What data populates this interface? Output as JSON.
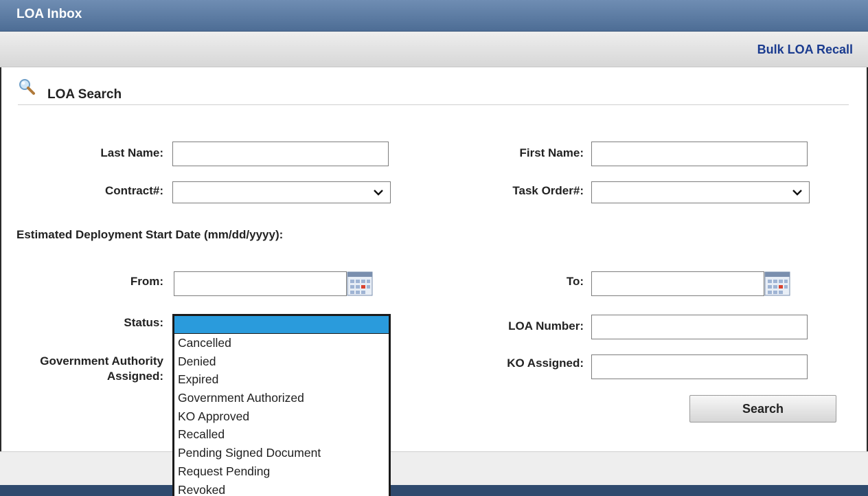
{
  "window": {
    "title": "LOA Inbox"
  },
  "toolbar": {
    "bulk_recall_label": "Bulk LOA Recall"
  },
  "search_section": {
    "title": "LOA Search",
    "icon": "magnifier-icon"
  },
  "form": {
    "last_name": {
      "label": "Last Name:",
      "value": ""
    },
    "first_name": {
      "label": "First Name:",
      "value": ""
    },
    "contract": {
      "label": "Contract#:",
      "value": ""
    },
    "task_order": {
      "label": "Task Order#:",
      "value": ""
    },
    "date_section_label": "Estimated Deployment Start Date (mm/dd/yyyy):",
    "from": {
      "label": "From:",
      "value": ""
    },
    "to": {
      "label": "To:",
      "value": ""
    },
    "status": {
      "label": "Status:",
      "selected": "",
      "options": [
        "Cancelled",
        "Denied",
        "Expired",
        "Government Authorized",
        "KO Approved",
        "Recalled",
        "Pending Signed Document",
        "Request Pending",
        "Revoked"
      ]
    },
    "loa_number": {
      "label": "LOA Number:",
      "value": ""
    },
    "gov_authority": {
      "label_line1": "Government Authority",
      "label_line2": "Assigned:"
    },
    "ko_assigned": {
      "label": "KO Assigned:",
      "value": ""
    },
    "search_button": "Search"
  },
  "colors": {
    "titlebar": "#5a7aa3",
    "link": "#1a3b8f",
    "dropdown_highlight": "#2a9bdc",
    "bottombar": "#2f4a6e"
  }
}
